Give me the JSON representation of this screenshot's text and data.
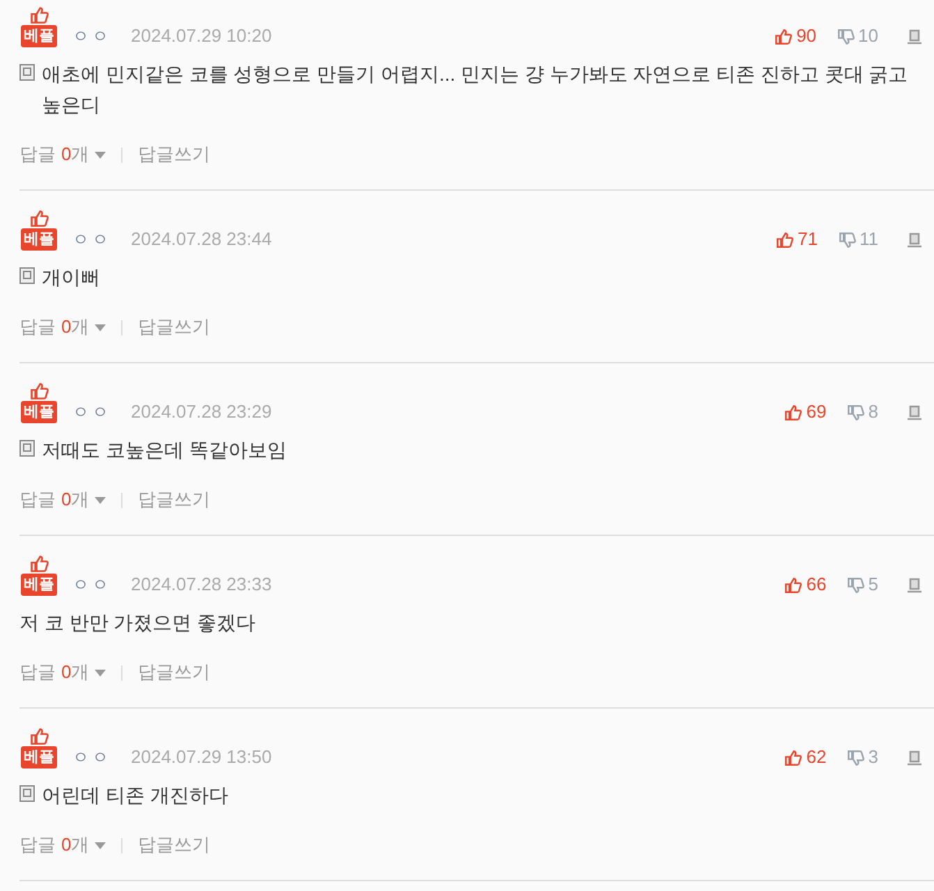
{
  "comments": [
    {
      "badge": "베플",
      "author": "ㅇㅇ",
      "date": "2024.07.29 10:20",
      "likes": "90",
      "dislikes": "10",
      "memo_icon": true,
      "text": "애초에 민지같은 코를 성형으로 만들기 어렵지... 민지는 걍 누가봐도 자연으로 티존 진하고 콧대 굵고 높은디",
      "reply_label": "답글",
      "reply_count": "0",
      "reply_unit": "개",
      "write_reply": "답글쓰기"
    },
    {
      "badge": "베플",
      "author": "ㅇㅇ",
      "date": "2024.07.28 23:44",
      "likes": "71",
      "dislikes": "11",
      "memo_icon": true,
      "text": "개이뻐",
      "reply_label": "답글",
      "reply_count": "0",
      "reply_unit": "개",
      "write_reply": "답글쓰기"
    },
    {
      "badge": "베플",
      "author": "ㅇㅇ",
      "date": "2024.07.28 23:29",
      "likes": "69",
      "dislikes": "8",
      "memo_icon": true,
      "text": "저때도 코높은데 똑같아보임",
      "reply_label": "답글",
      "reply_count": "0",
      "reply_unit": "개",
      "write_reply": "답글쓰기"
    },
    {
      "badge": "베플",
      "author": "ㅇㅇ",
      "date": "2024.07.28 23:33",
      "likes": "66",
      "dislikes": "5",
      "memo_icon": false,
      "text": "저 코 반만 가졌으면 좋겠다",
      "reply_label": "답글",
      "reply_count": "0",
      "reply_unit": "개",
      "write_reply": "답글쓰기"
    },
    {
      "badge": "베플",
      "author": "ㅇㅇ",
      "date": "2024.07.29 13:50",
      "likes": "62",
      "dislikes": "3",
      "memo_icon": true,
      "text": "어린데 티존 개진하다",
      "reply_label": "답글",
      "reply_count": "0",
      "reply_unit": "개",
      "write_reply": "답글쓰기"
    }
  ]
}
